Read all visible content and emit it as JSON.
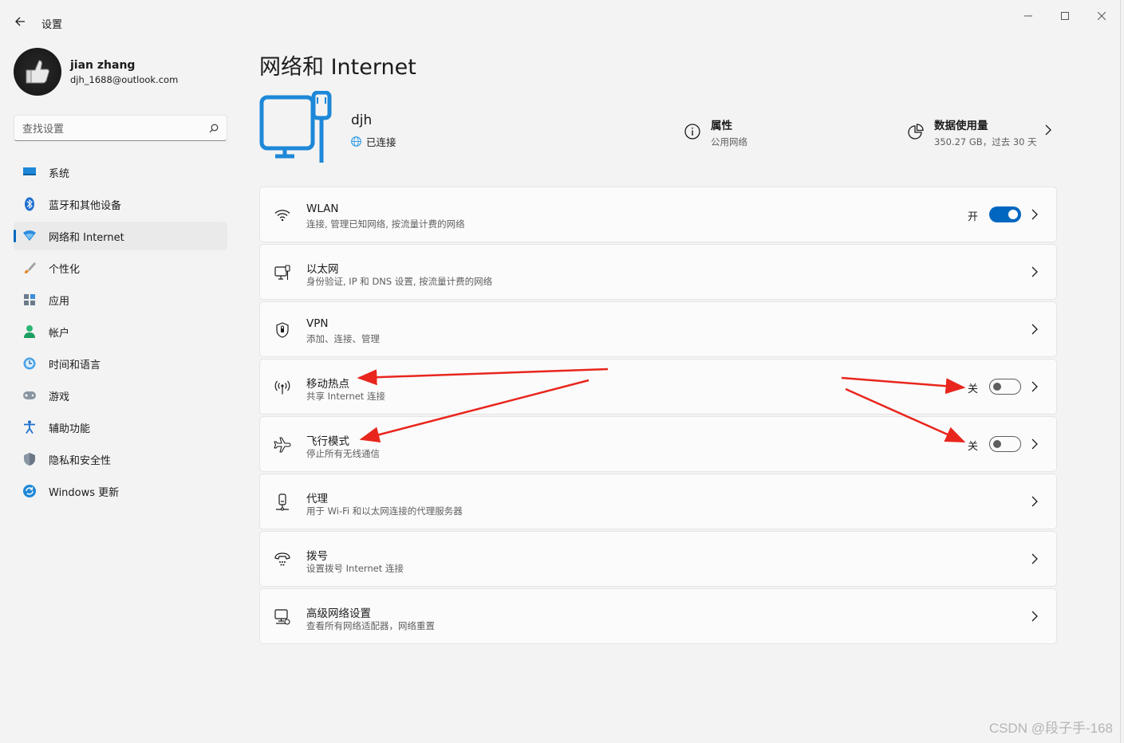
{
  "window": {
    "app_title": "设置"
  },
  "profile": {
    "name": "jian zhang",
    "email": "djh_1688@outlook.com"
  },
  "search": {
    "placeholder": "查找设置"
  },
  "sidebar": {
    "items": [
      {
        "label": "系统",
        "icon": "system-icon",
        "active": false
      },
      {
        "label": "蓝牙和其他设备",
        "icon": "bluetooth-icon",
        "active": false
      },
      {
        "label": "网络和 Internet",
        "icon": "network-icon",
        "active": true
      },
      {
        "label": "个性化",
        "icon": "personalize-icon",
        "active": false
      },
      {
        "label": "应用",
        "icon": "apps-icon",
        "active": false
      },
      {
        "label": "帐户",
        "icon": "account-icon",
        "active": false
      },
      {
        "label": "时间和语言",
        "icon": "time-language-icon",
        "active": false
      },
      {
        "label": "游戏",
        "icon": "gaming-icon",
        "active": false
      },
      {
        "label": "辅助功能",
        "icon": "accessibility-icon",
        "active": false
      },
      {
        "label": "隐私和安全性",
        "icon": "privacy-shield-icon",
        "active": false
      },
      {
        "label": "Windows 更新",
        "icon": "windows-update-icon",
        "active": false
      }
    ]
  },
  "page": {
    "title": "网络和 Internet"
  },
  "hero": {
    "network_name": "djh",
    "status": "已连接",
    "properties_title": "属性",
    "properties_sub": "公用网络",
    "usage_title": "数据使用量",
    "usage_sub": "350.27 GB，过去 30 天"
  },
  "settings": [
    {
      "title": "WLAN",
      "sub": "连接, 管理已知网络, 按流量计费的网络",
      "icon": "wifi-icon",
      "toggle": "on",
      "toggle_label": "开"
    },
    {
      "title": "以太网",
      "sub": "身份验证, IP 和 DNS 设置, 按流量计费的网络",
      "icon": "ethernet-icon",
      "toggle": null
    },
    {
      "title": "VPN",
      "sub": "添加、连接、管理",
      "icon": "vpn-shield-icon",
      "toggle": null
    },
    {
      "title": "移动热点",
      "sub": "共享 Internet 连接",
      "icon": "hotspot-icon",
      "toggle": "off",
      "toggle_label": "关"
    },
    {
      "title": "飞行模式",
      "sub": "停止所有无线通信",
      "icon": "airplane-icon",
      "toggle": "off",
      "toggle_label": "关"
    },
    {
      "title": "代理",
      "sub": "用于 Wi-Fi 和以太网连接的代理服务器",
      "icon": "proxy-icon",
      "toggle": null
    },
    {
      "title": "拨号",
      "sub": "设置拨号 Internet 连接",
      "icon": "dialup-icon",
      "toggle": null
    },
    {
      "title": "高级网络设置",
      "sub": "查看所有网络适配器，网络重置",
      "icon": "advanced-network-icon",
      "toggle": null
    }
  ],
  "colors": {
    "accent": "#0067c0",
    "annotation_arrow": "#e8261d"
  },
  "watermark": "CSDN @段子手-168"
}
